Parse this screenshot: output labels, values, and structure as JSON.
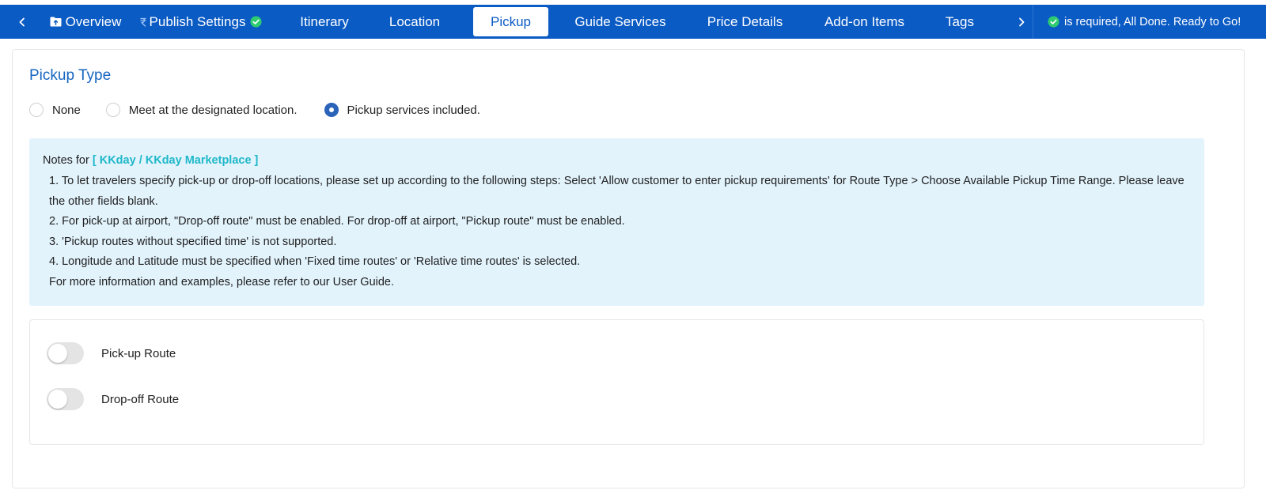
{
  "tabs": [
    {
      "id": "overview",
      "label": "Overview",
      "icon": "folder-upload-icon"
    },
    {
      "id": "publish",
      "label": "Publish Settings",
      "icon": "rupee-icon",
      "status_icon": "check-circle-icon"
    },
    {
      "id": "itinerary",
      "label": "Itinerary"
    },
    {
      "id": "location",
      "label": "Location"
    },
    {
      "id": "pickup",
      "label": "Pickup",
      "active": true
    },
    {
      "id": "guide",
      "label": "Guide Services"
    },
    {
      "id": "price",
      "label": "Price Details"
    },
    {
      "id": "addon",
      "label": "Add-on Items"
    },
    {
      "id": "tags",
      "label": "Tags"
    }
  ],
  "status": {
    "text": "is required,  All Done. Ready to Go!",
    "icon": "check-circle-icon"
  },
  "pickup_type": {
    "title": "Pickup Type",
    "options": [
      {
        "label": "None",
        "selected": false
      },
      {
        "label": "Meet at the designated location.",
        "selected": false
      },
      {
        "label": "Pickup services included.",
        "selected": true
      }
    ]
  },
  "notes": {
    "prefix": "Notes for",
    "brand": "[ KKday / KKday Marketplace ]",
    "lines": [
      "1. To let travelers specify pick-up or drop-off locations, please set up according to the following steps: Select 'Allow customer to enter pickup requirements' for Route Type > Choose Available Pickup Time Range. Please leave the other fields blank.",
      "2. For pick-up at airport, \"Drop-off route\" must be enabled. For drop-off at airport, \"Pickup route\" must be enabled.",
      "3. 'Pickup routes without specified time' is not supported.",
      "4. Longitude and Latitude must be specified when 'Fixed time routes' or 'Relative time routes' is selected.",
      "For more information and examples, please refer to our User Guide."
    ]
  },
  "routes": [
    {
      "label": "Pick-up Route",
      "enabled": false
    },
    {
      "label": "Drop-off Route",
      "enabled": false
    }
  ],
  "colors": {
    "tabbar": "#0b5bc4",
    "accent": "#1565c0",
    "success": "#2ecc71",
    "brand_teal": "#1fb8c9",
    "notes_bg": "#e2f3fc"
  }
}
